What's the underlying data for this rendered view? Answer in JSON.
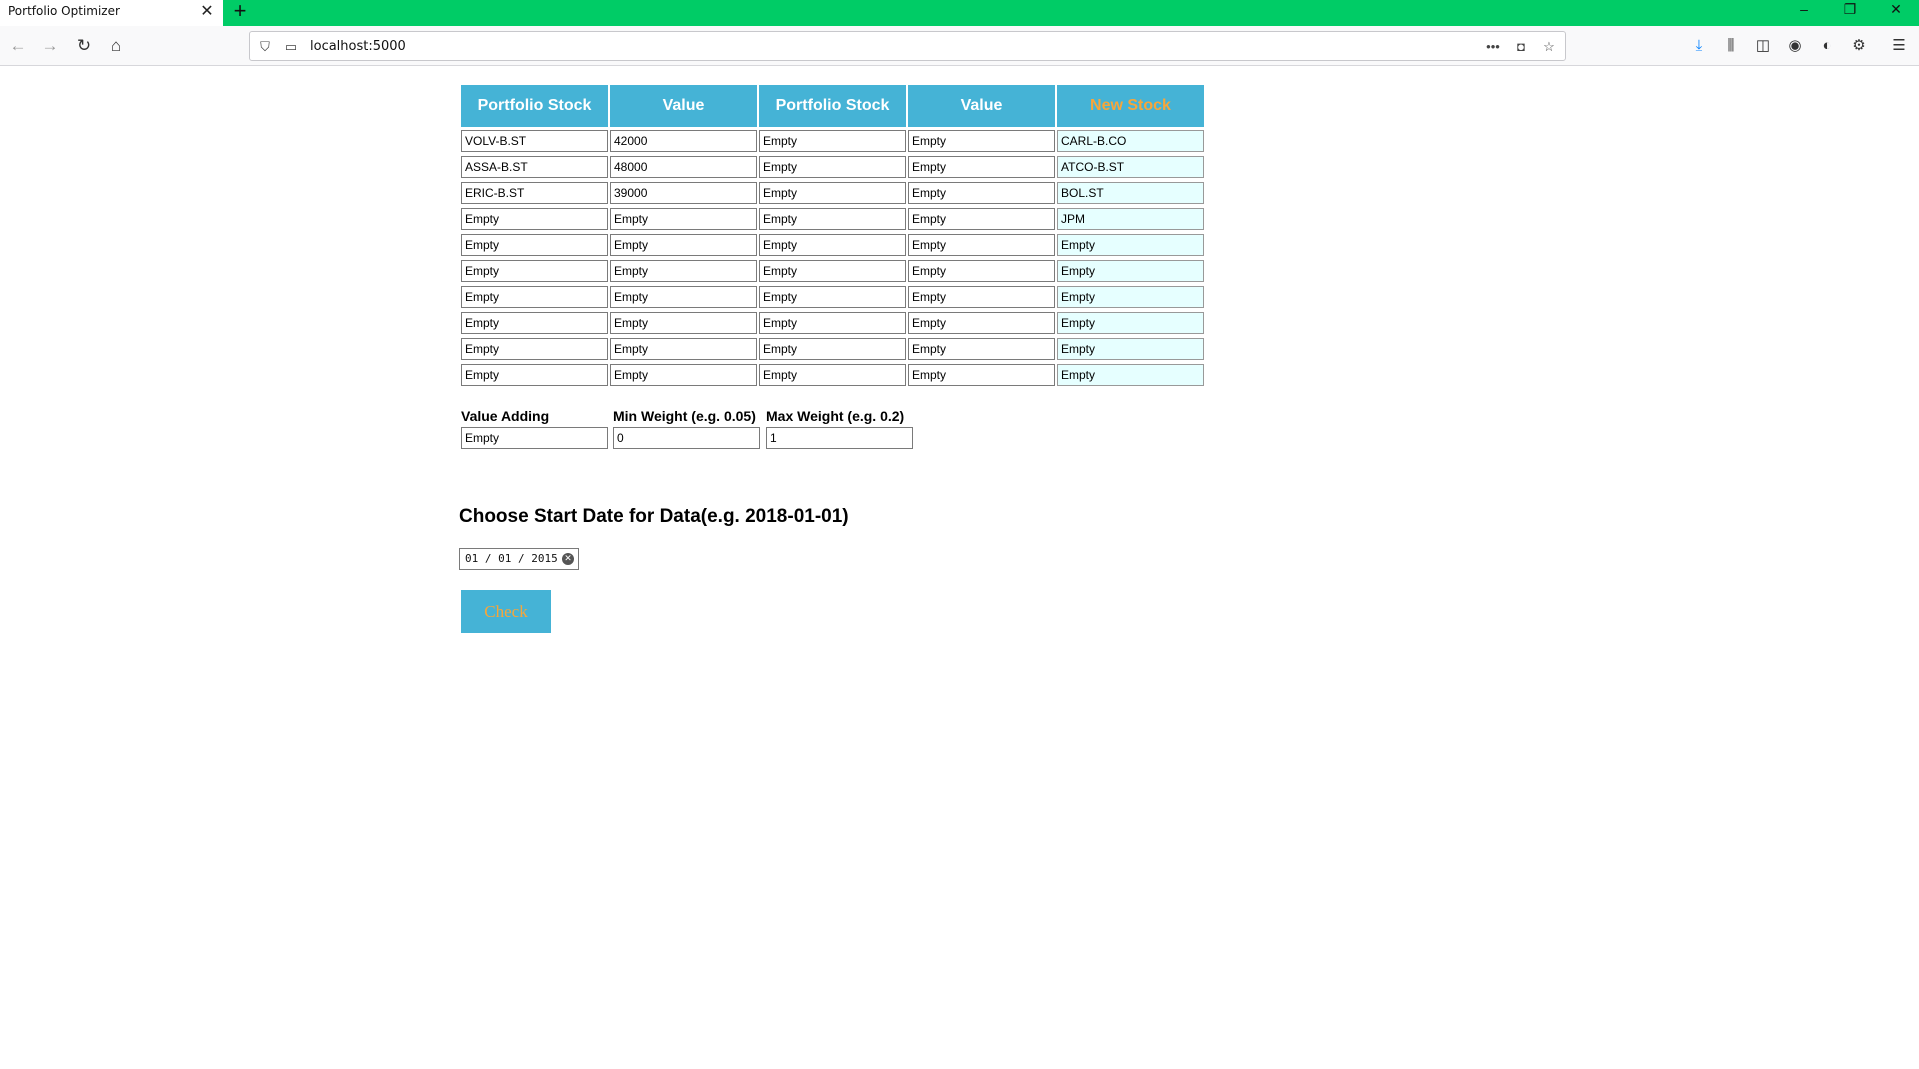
{
  "browser": {
    "tab_title": "Portfolio Optimizer",
    "tab_close": "✕",
    "new_tab": "+",
    "url": "localhost:5000",
    "accent_color": "#00cc66",
    "window_controls": [
      "–",
      "❐",
      "✕"
    ]
  },
  "table": {
    "headers": [
      "Portfolio Stock",
      "Value",
      "Portfolio Stock",
      "Value",
      "New Stock"
    ],
    "header_color": "#45b3d6",
    "new_stock_header_color": "#f7a63a",
    "rows": [
      [
        "VOLV-B.ST",
        "42000",
        "Empty",
        "Empty",
        "CARL-B.CO"
      ],
      [
        "ASSA-B.ST",
        "48000",
        "Empty",
        "Empty",
        "ATCO-B.ST"
      ],
      [
        "ERIC-B.ST",
        "39000",
        "Empty",
        "Empty",
        "BOL.ST"
      ],
      [
        "Empty",
        "Empty",
        "Empty",
        "Empty",
        "JPM"
      ],
      [
        "Empty",
        "Empty",
        "Empty",
        "Empty",
        "Empty"
      ],
      [
        "Empty",
        "Empty",
        "Empty",
        "Empty",
        "Empty"
      ],
      [
        "Empty",
        "Empty",
        "Empty",
        "Empty",
        "Empty"
      ],
      [
        "Empty",
        "Empty",
        "Empty",
        "Empty",
        "Empty"
      ],
      [
        "Empty",
        "Empty",
        "Empty",
        "Empty",
        "Empty"
      ],
      [
        "Empty",
        "Empty",
        "Empty",
        "Empty",
        "Empty"
      ]
    ]
  },
  "params": {
    "value_adding_label": "Value Adding",
    "value_adding_value": "Empty",
    "min_weight_label": "Min Weight (e.g. 0.05)",
    "min_weight_value": "0",
    "max_weight_label": "Max Weight (e.g. 0.2)",
    "max_weight_value": "1"
  },
  "date": {
    "title": "Choose Start Date for Data(e.g. 2018-01-01)",
    "value": "01 / 01 / 2015"
  },
  "check_button": "Check"
}
